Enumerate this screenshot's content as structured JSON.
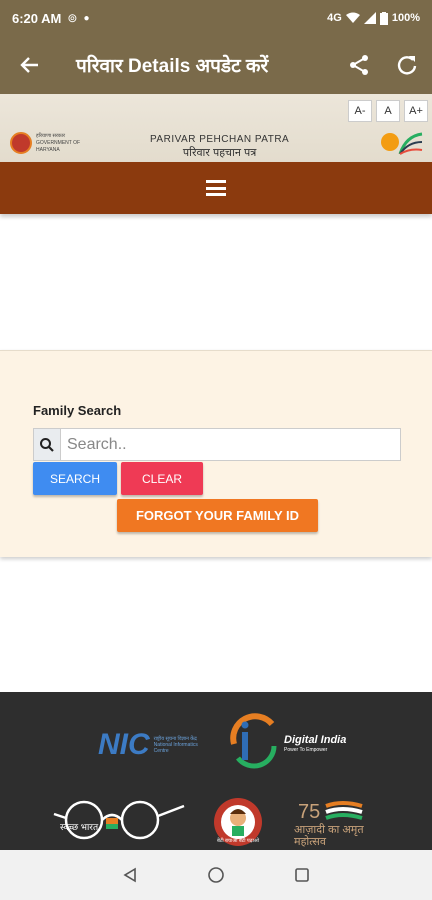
{
  "status_bar": {
    "time": "6:20 AM",
    "network": "4G",
    "battery": "100%"
  },
  "app_bar": {
    "title": "परिवार Details अपडेट करें"
  },
  "banner": {
    "font_buttons": [
      "A-",
      "A",
      "A+"
    ],
    "gov_logo_text": "हरियाणा सरकार GOVERNMENT OF HARYANA",
    "ppp_title_en": "PARIVAR PEHCHAN PATRA",
    "ppp_title_hi": "परिवार पहचान पत्र"
  },
  "family_search": {
    "label": "Family Search",
    "placeholder": "Search..",
    "search_button": "SEARCH",
    "clear_button": "CLEAR",
    "forgot_button": "FORGOT YOUR FAMILY ID"
  },
  "footer": {
    "nic_logo": "NIC",
    "nic_text": "राष्ट्रीय सूचना विज्ञान केंद्र National Informatics Centre",
    "digital_india": "Digital India",
    "digital_india_sub": "Power To Empower",
    "swachh_text": "स्वच्छ भारत",
    "bbbp_text": "बेटी बचाओ बेटी पढ़ाओ",
    "azadi_text": "आज़ादी का अमृत महोत्सव"
  },
  "colors": {
    "app_bar": "#7a6a4a",
    "menu_bar": "#8b3a0e",
    "search": "#3f8cf1",
    "clear": "#ef3a55",
    "forgot": "#f07722"
  }
}
